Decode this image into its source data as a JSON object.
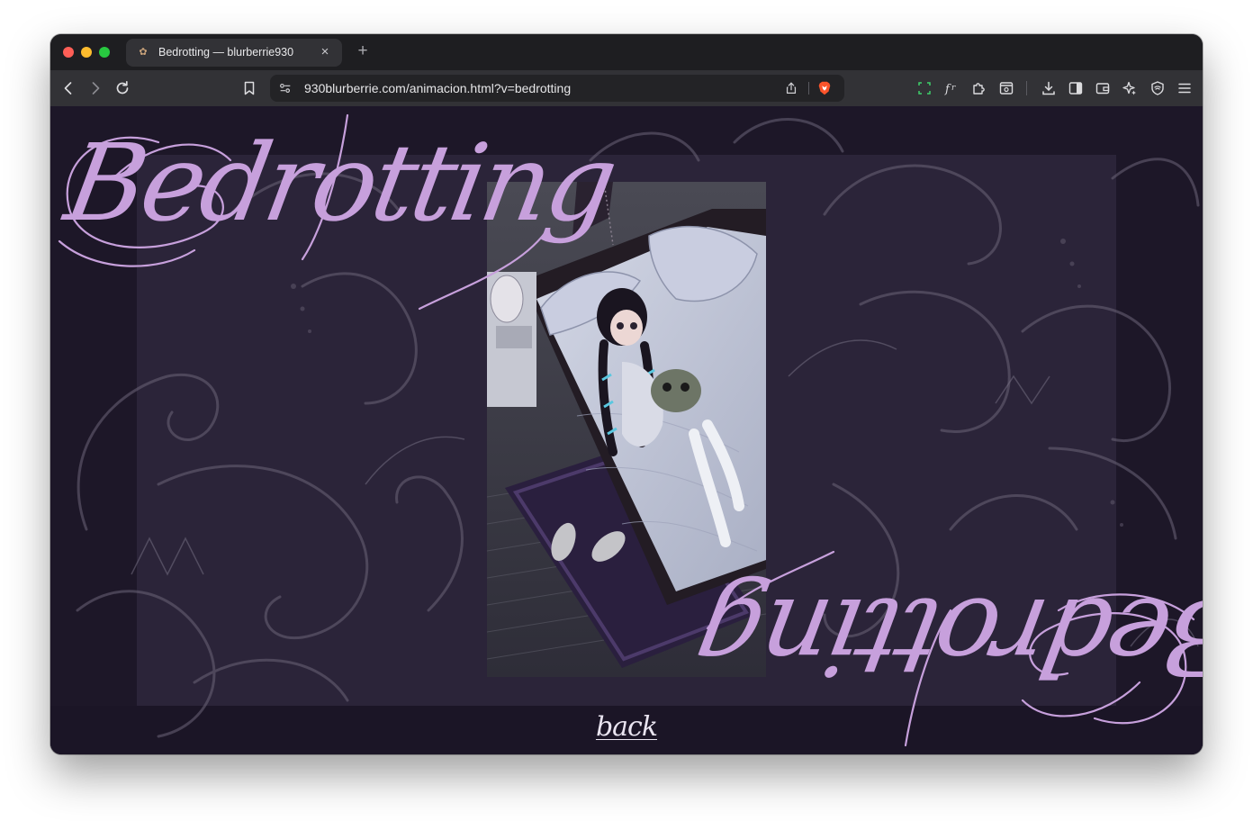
{
  "browser": {
    "tab": {
      "title": "Bedrotting — blurberrie930",
      "favicon": "site-favicon",
      "close_label": "×"
    },
    "new_tab_label": "+",
    "url": "930blurberrie.com/animacion.html?v=bedrotting",
    "icons": {
      "nav": [
        "back-icon",
        "forward-icon",
        "reload-icon",
        "bookmark-icon"
      ],
      "url": [
        "site-settings-icon",
        "share-icon",
        "brave-shields-icon"
      ],
      "right": [
        "extension-frame-icon",
        "formula-icon",
        "extensions-icon",
        "reader-mode-icon",
        "downloads-icon",
        "sidebar-icon",
        "wallet-icon",
        "leo-ai-icon",
        "vpn-shield-icon",
        "menu-icon"
      ]
    },
    "colors": {
      "titlebar": "#1e1e21",
      "toolbar": "#323236",
      "urlbar": "#232326"
    }
  },
  "page": {
    "title_top": "Bedrotting",
    "title_bottom": "Bedrotting",
    "back_label": "back",
    "colors": {
      "background": "#1d1728",
      "panel": "#2b2439",
      "title": "#c7a0dc",
      "link": "#e9e4f0"
    }
  }
}
